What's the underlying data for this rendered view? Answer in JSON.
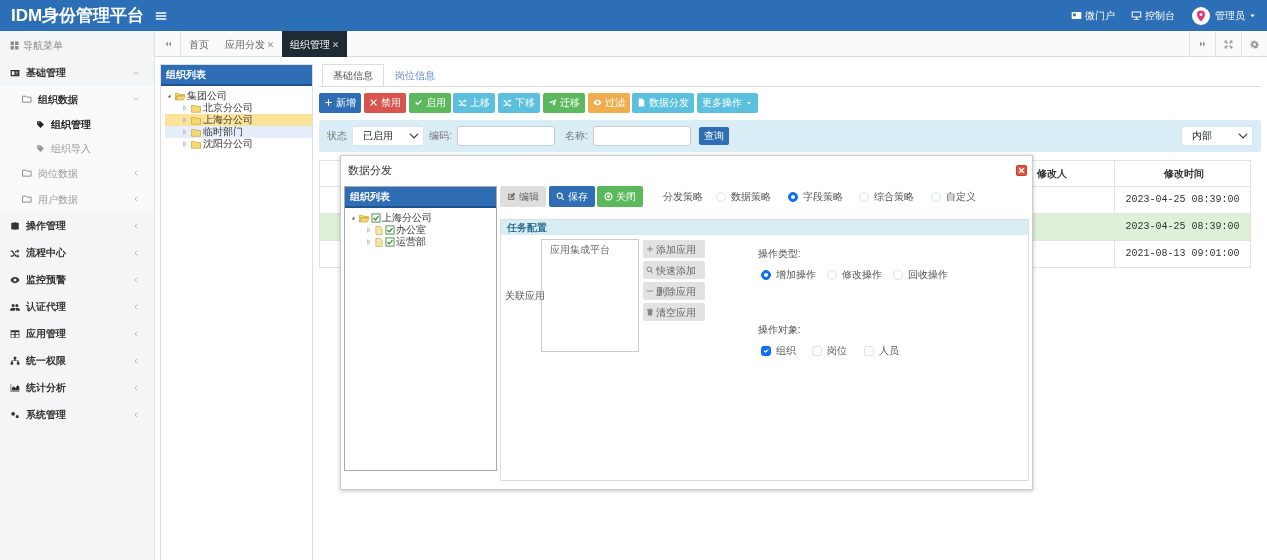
{
  "header": {
    "title": "IDM身份管理平台",
    "links": [
      {
        "label": "微门户"
      },
      {
        "label": "控制台"
      }
    ],
    "user": {
      "label": "管理员"
    }
  },
  "sidebar": {
    "header": "导航菜单",
    "items": [
      {
        "label": "基础管理",
        "expanded": true,
        "children": [
          {
            "label": "组织数据",
            "expanded": true,
            "children": [
              {
                "label": "组织管理",
                "selected": true
              },
              {
                "label": "组织导入",
                "selected": false
              }
            ]
          },
          {
            "label": "岗位数据",
            "expanded": false
          },
          {
            "label": "用户数据",
            "expanded": false
          }
        ]
      },
      {
        "label": "操作管理",
        "expanded": false
      },
      {
        "label": "流程中心",
        "expanded": false
      },
      {
        "label": "监控预警",
        "expanded": false
      },
      {
        "label": "认证代理",
        "expanded": false
      },
      {
        "label": "应用管理",
        "expanded": false
      },
      {
        "label": "统一权限",
        "expanded": false
      },
      {
        "label": "统计分析",
        "expanded": false
      },
      {
        "label": "系统管理",
        "expanded": false
      }
    ]
  },
  "page_tabs": [
    {
      "label": "首页",
      "closable": false,
      "selected": false
    },
    {
      "label": "应用分发",
      "closable": true,
      "selected": false
    },
    {
      "label": "组织管理",
      "closable": true,
      "selected": true
    }
  ],
  "org_panel": {
    "title": "组织列表",
    "tree": [
      {
        "label": "集团公司",
        "expanded": true,
        "selected": false,
        "hovered": false,
        "children": [
          {
            "label": "北京分公司",
            "expanded": false,
            "selected": false,
            "hovered": false
          },
          {
            "label": "上海分公司",
            "expanded": false,
            "selected": true,
            "hovered": false
          },
          {
            "label": "临时部门",
            "expanded": false,
            "selected": false,
            "hovered": true
          },
          {
            "label": "沈阳分公司",
            "expanded": false,
            "selected": false,
            "hovered": false
          }
        ]
      }
    ]
  },
  "detail_tabs": [
    {
      "label": "基础信息",
      "selected": true
    },
    {
      "label": "岗位信息",
      "selected": false
    }
  ],
  "toolbar": [
    {
      "label": "新增",
      "kind": "primary",
      "dropdown": false
    },
    {
      "label": "禁用",
      "kind": "danger",
      "dropdown": false
    },
    {
      "label": "启用",
      "kind": "success",
      "dropdown": false
    },
    {
      "label": "上移",
      "kind": "info",
      "dropdown": false
    },
    {
      "label": "下移",
      "kind": "info",
      "dropdown": false
    },
    {
      "label": "迁移",
      "kind": "success",
      "dropdown": false
    },
    {
      "label": "过滤",
      "kind": "warning",
      "dropdown": false
    },
    {
      "label": "数据分发",
      "kind": "info",
      "dropdown": false
    },
    {
      "label": "更多操作",
      "kind": "info",
      "dropdown": true
    }
  ],
  "filter": {
    "status_label": "状态",
    "status_value": "已启用",
    "code_label": "编码:",
    "name_label": "名称:",
    "search_button": "查询",
    "scope_value": "内部"
  },
  "table": {
    "columns": [
      "修改人",
      "修改时间"
    ],
    "rows": [
      {
        "time": "2023-04-25 08:39:00",
        "selected": false
      },
      {
        "time": "2023-04-25 08:39:00",
        "selected": true
      },
      {
        "time": "2021-08-13 09:01:00",
        "selected": false
      }
    ]
  },
  "dialog": {
    "title": "数据分发",
    "tree_title": "组织列表",
    "tree": [
      {
        "label": "上海分公司",
        "expanded": true,
        "checked": true,
        "children": [
          {
            "label": "办公室",
            "expanded": false,
            "checked": true
          },
          {
            "label": "运营部",
            "expanded": false,
            "checked": true
          }
        ]
      }
    ],
    "buttons": [
      {
        "label": "编辑",
        "kind": "secondary",
        "disabled": true
      },
      {
        "label": "保存",
        "kind": "primary",
        "disabled": false
      },
      {
        "label": "关闭",
        "kind": "success",
        "disabled": false
      }
    ],
    "strategy": {
      "label": "分发策略",
      "options": [
        {
          "label": "数据策略",
          "selected": false
        },
        {
          "label": "字段策略",
          "selected": true
        },
        {
          "label": "综合策略",
          "selected": false
        },
        {
          "label": "自定义",
          "selected": false
        }
      ]
    },
    "task": {
      "title": "任务配置",
      "apps_label": "关联应用",
      "apps": [
        "应用集成平台"
      ],
      "app_buttons": [
        {
          "label": "添加应用",
          "disabled": true
        },
        {
          "label": "快速添加",
          "disabled": true
        },
        {
          "label": "删除应用",
          "disabled": true
        },
        {
          "label": "清空应用",
          "disabled": true
        }
      ],
      "operation_type": {
        "label": "操作类型:",
        "options": [
          {
            "label": "增加操作",
            "selected": true
          },
          {
            "label": "修改操作",
            "selected": false
          },
          {
            "label": "回收操作",
            "selected": false
          }
        ]
      },
      "operation_target": {
        "label": "操作对象:",
        "options": [
          {
            "label": "组织",
            "checked": true
          },
          {
            "label": "岗位",
            "checked": false
          },
          {
            "label": "人员",
            "checked": false
          }
        ]
      }
    }
  }
}
